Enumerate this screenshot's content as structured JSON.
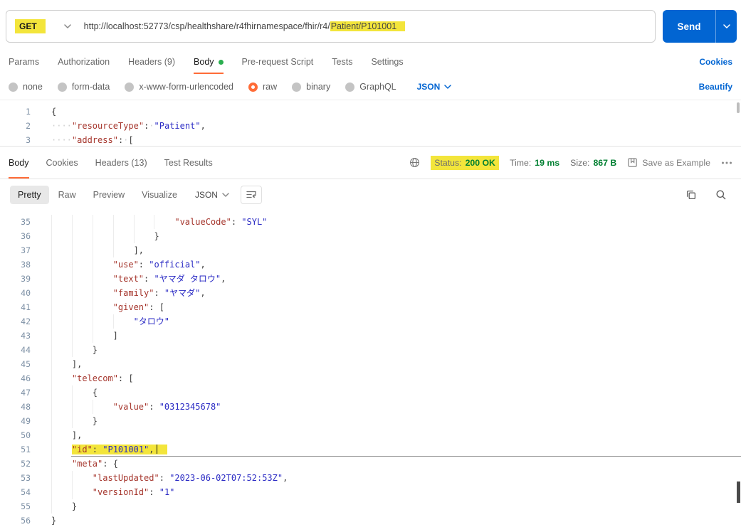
{
  "colors": {
    "accent": "#FF6C37",
    "blue": "#0265D2",
    "green": "#007F31",
    "dot": "#2AAE4F",
    "hl": "#F3E53B",
    "key": "#A5352C",
    "str": "#2A2AC4",
    "punct": "#3F3F3F",
    "ln": "#7D90A5",
    "ws": "#CFCFCF"
  },
  "request": {
    "method": "GET",
    "url_plain": "http://localhost:52773/csp/healthshare/r4fhirnamespace/fhir/r4/",
    "url_highlight": "Patient/P101001",
    "send_label": "Send",
    "cookies_link": "Cookies",
    "beautify_link": "Beautify",
    "raw_language": "JSON",
    "tabs": [
      {
        "label": "Params"
      },
      {
        "label": "Authorization"
      },
      {
        "label": "Headers (9)"
      },
      {
        "label": "Body"
      },
      {
        "label": "Pre-request Script"
      },
      {
        "label": "Tests"
      },
      {
        "label": "Settings"
      }
    ],
    "body_modes": [
      {
        "label": "none"
      },
      {
        "label": "form-data"
      },
      {
        "label": "x-www-form-urlencoded"
      },
      {
        "label": "raw"
      },
      {
        "label": "binary"
      },
      {
        "label": "GraphQL"
      }
    ],
    "editor_lines": [
      {
        "n": 1,
        "ind": 0,
        "t": [
          [
            "p",
            "{"
          ]
        ]
      },
      {
        "n": 2,
        "ind": 0,
        "t": [
          [
            "ws",
            "····"
          ],
          [
            "k",
            "\"resourceType\""
          ],
          [
            "p",
            ":"
          ],
          [
            "ws",
            "·"
          ],
          [
            "s",
            "\"Patient\""
          ],
          [
            "p",
            ","
          ]
        ]
      },
      {
        "n": 3,
        "ind": 0,
        "t": [
          [
            "ws",
            "····"
          ],
          [
            "k",
            "\"address\""
          ],
          [
            "p",
            ":"
          ],
          [
            "ws",
            "·"
          ],
          [
            "p",
            "["
          ]
        ]
      }
    ]
  },
  "response": {
    "tabs": [
      {
        "label": "Body"
      },
      {
        "label": "Cookies"
      },
      {
        "label": "Headers (13)"
      },
      {
        "label": "Test Results"
      }
    ],
    "meta": {
      "status_label": "Status:",
      "status_value": "200 OK",
      "time_label": "Time:",
      "time_value": "19 ms",
      "size_label": "Size:",
      "size_value": "867 B",
      "save_as_example": "Save as Example"
    },
    "view_tabs": [
      {
        "label": "Pretty"
      },
      {
        "label": "Raw"
      },
      {
        "label": "Preview"
      },
      {
        "label": "Visualize"
      }
    ],
    "format": "JSON",
    "code_lines": [
      {
        "n": 35,
        "ind": 6,
        "t": [
          [
            "k",
            "\"valueCode\""
          ],
          [
            "p",
            ": "
          ],
          [
            "s",
            "\"SYL\""
          ]
        ]
      },
      {
        "n": 36,
        "ind": 5,
        "t": [
          [
            "p",
            "}"
          ]
        ]
      },
      {
        "n": 37,
        "ind": 4,
        "t": [
          [
            "p",
            "],"
          ]
        ]
      },
      {
        "n": 38,
        "ind": 3,
        "t": [
          [
            "k",
            "\"use\""
          ],
          [
            "p",
            ": "
          ],
          [
            "s",
            "\"official\""
          ],
          [
            "p",
            ","
          ]
        ]
      },
      {
        "n": 39,
        "ind": 3,
        "t": [
          [
            "k",
            "\"text\""
          ],
          [
            "p",
            ": "
          ],
          [
            "s",
            "\"ヤマダ タロウ\""
          ],
          [
            "p",
            ","
          ]
        ]
      },
      {
        "n": 40,
        "ind": 3,
        "t": [
          [
            "k",
            "\"family\""
          ],
          [
            "p",
            ": "
          ],
          [
            "s",
            "\"ヤマダ\""
          ],
          [
            "p",
            ","
          ]
        ]
      },
      {
        "n": 41,
        "ind": 3,
        "t": [
          [
            "k",
            "\"given\""
          ],
          [
            "p",
            ": ["
          ]
        ]
      },
      {
        "n": 42,
        "ind": 4,
        "t": [
          [
            "s",
            "\"タロウ\""
          ]
        ]
      },
      {
        "n": 43,
        "ind": 3,
        "t": [
          [
            "p",
            "]"
          ]
        ]
      },
      {
        "n": 44,
        "ind": 2,
        "t": [
          [
            "p",
            "}"
          ]
        ]
      },
      {
        "n": 45,
        "ind": 1,
        "t": [
          [
            "p",
            "],"
          ]
        ]
      },
      {
        "n": 46,
        "ind": 1,
        "t": [
          [
            "k",
            "\"telecom\""
          ],
          [
            "p",
            ": ["
          ]
        ]
      },
      {
        "n": 47,
        "ind": 2,
        "t": [
          [
            "p",
            "{"
          ]
        ]
      },
      {
        "n": 48,
        "ind": 3,
        "t": [
          [
            "k",
            "\"value\""
          ],
          [
            "p",
            ": "
          ],
          [
            "s",
            "\"0312345678\""
          ]
        ]
      },
      {
        "n": 49,
        "ind": 2,
        "t": [
          [
            "p",
            "}"
          ]
        ]
      },
      {
        "n": 50,
        "ind": 1,
        "t": [
          [
            "p",
            "],"
          ]
        ]
      },
      {
        "n": 51,
        "ind": 1,
        "hl": true,
        "t": [
          [
            "k",
            "\"id\""
          ],
          [
            "p",
            ": "
          ],
          [
            "s",
            "\"P101001\""
          ],
          [
            "p",
            ","
          ]
        ]
      },
      {
        "n": 52,
        "ind": 1,
        "t": [
          [
            "k",
            "\"meta\""
          ],
          [
            "p",
            ": {"
          ]
        ]
      },
      {
        "n": 53,
        "ind": 2,
        "t": [
          [
            "k",
            "\"lastUpdated\""
          ],
          [
            "p",
            ": "
          ],
          [
            "s",
            "\"2023-06-02T07:52:53Z\""
          ],
          [
            "p",
            ","
          ]
        ]
      },
      {
        "n": 54,
        "ind": 2,
        "t": [
          [
            "k",
            "\"versionId\""
          ],
          [
            "p",
            ": "
          ],
          [
            "s",
            "\"1\""
          ]
        ]
      },
      {
        "n": 55,
        "ind": 1,
        "t": [
          [
            "p",
            "}"
          ]
        ]
      },
      {
        "n": 56,
        "ind": 0,
        "t": [
          [
            "p",
            "}"
          ]
        ]
      }
    ]
  }
}
